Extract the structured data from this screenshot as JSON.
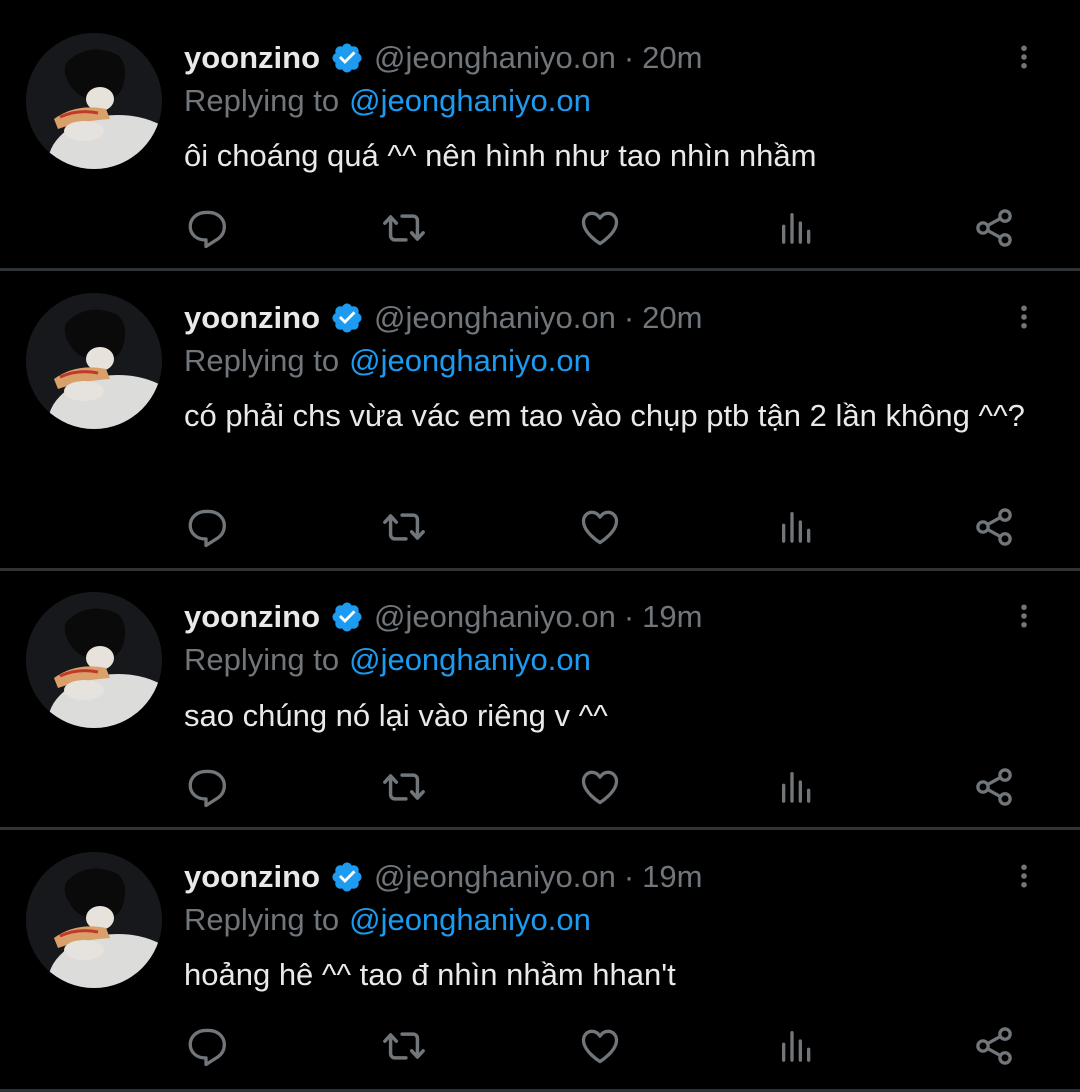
{
  "colors": {
    "background": "#000000",
    "text_primary": "#e7e9ea",
    "text_secondary": "#71767b",
    "accent": "#1d9bf0",
    "divider": "#2f3336"
  },
  "icons": {
    "verified": "verified-badge-icon",
    "more": "more-vertical-icon",
    "reply": "comment-icon",
    "retweet": "retweet-icon",
    "like": "heart-icon",
    "views": "analytics-icon",
    "share": "share-icon"
  },
  "tweets": [
    {
      "display_name": "yoonzino",
      "handle": "@jeonghaniyo.on",
      "separator": "·",
      "time": "20m",
      "replying_label": "Replying to",
      "replying_to": "@jeonghaniyo.on",
      "text": "ôi choáng quá ^^ nên hình như tao nhìn nhầm"
    },
    {
      "display_name": "yoonzino",
      "handle": "@jeonghaniyo.on",
      "separator": "·",
      "time": "20m",
      "replying_label": "Replying to",
      "replying_to": "@jeonghaniyo.on",
      "text": "có phải chs vừa vác em tao vào chụp ptb tận 2 lần không ^^?"
    },
    {
      "display_name": "yoonzino",
      "handle": "@jeonghaniyo.on",
      "separator": "·",
      "time": "19m",
      "replying_label": "Replying to",
      "replying_to": "@jeonghaniyo.on",
      "text": "sao chúng nó lại vào riêng v ^^"
    },
    {
      "display_name": "yoonzino",
      "handle": "@jeonghaniyo.on",
      "separator": "·",
      "time": "19m",
      "replying_label": "Replying to",
      "replying_to": "@jeonghaniyo.on",
      "text": "hoảng hê ^^ tao đ nhìn nhầm hhan't"
    }
  ]
}
